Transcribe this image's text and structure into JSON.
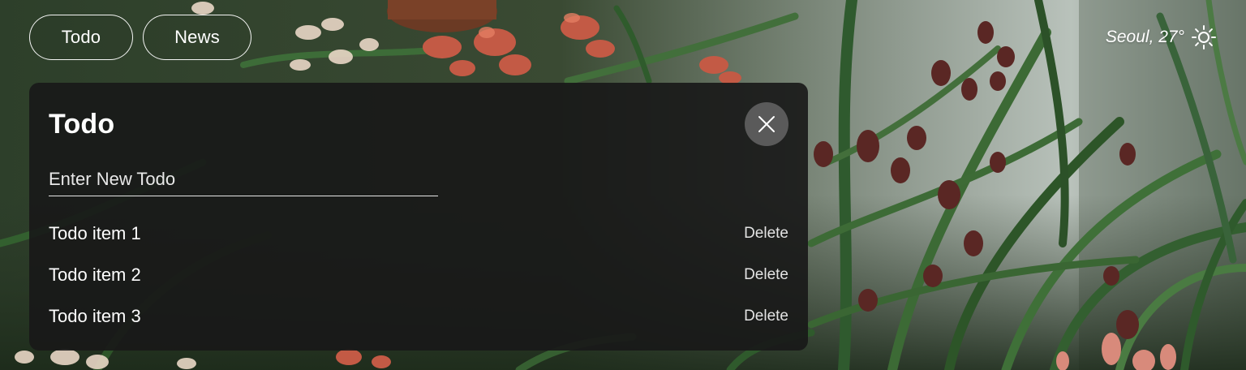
{
  "nav": {
    "items": [
      {
        "label": "Todo"
      },
      {
        "label": "News"
      }
    ]
  },
  "weather": {
    "text": "Seoul, 27°",
    "icon": "sun-icon"
  },
  "todo_panel": {
    "title": "Todo",
    "input": {
      "placeholder": "Enter New Todo",
      "value": ""
    },
    "items": [
      {
        "text": "Todo item 1",
        "action_label": "Delete"
      },
      {
        "text": "Todo item 2",
        "action_label": "Delete"
      },
      {
        "text": "Todo item 3",
        "action_label": "Delete"
      }
    ],
    "close_icon": "close-icon"
  },
  "colors": {
    "panel_background": "#181818",
    "close_button_background": "#5a5a5a",
    "text": "#ffffff"
  }
}
